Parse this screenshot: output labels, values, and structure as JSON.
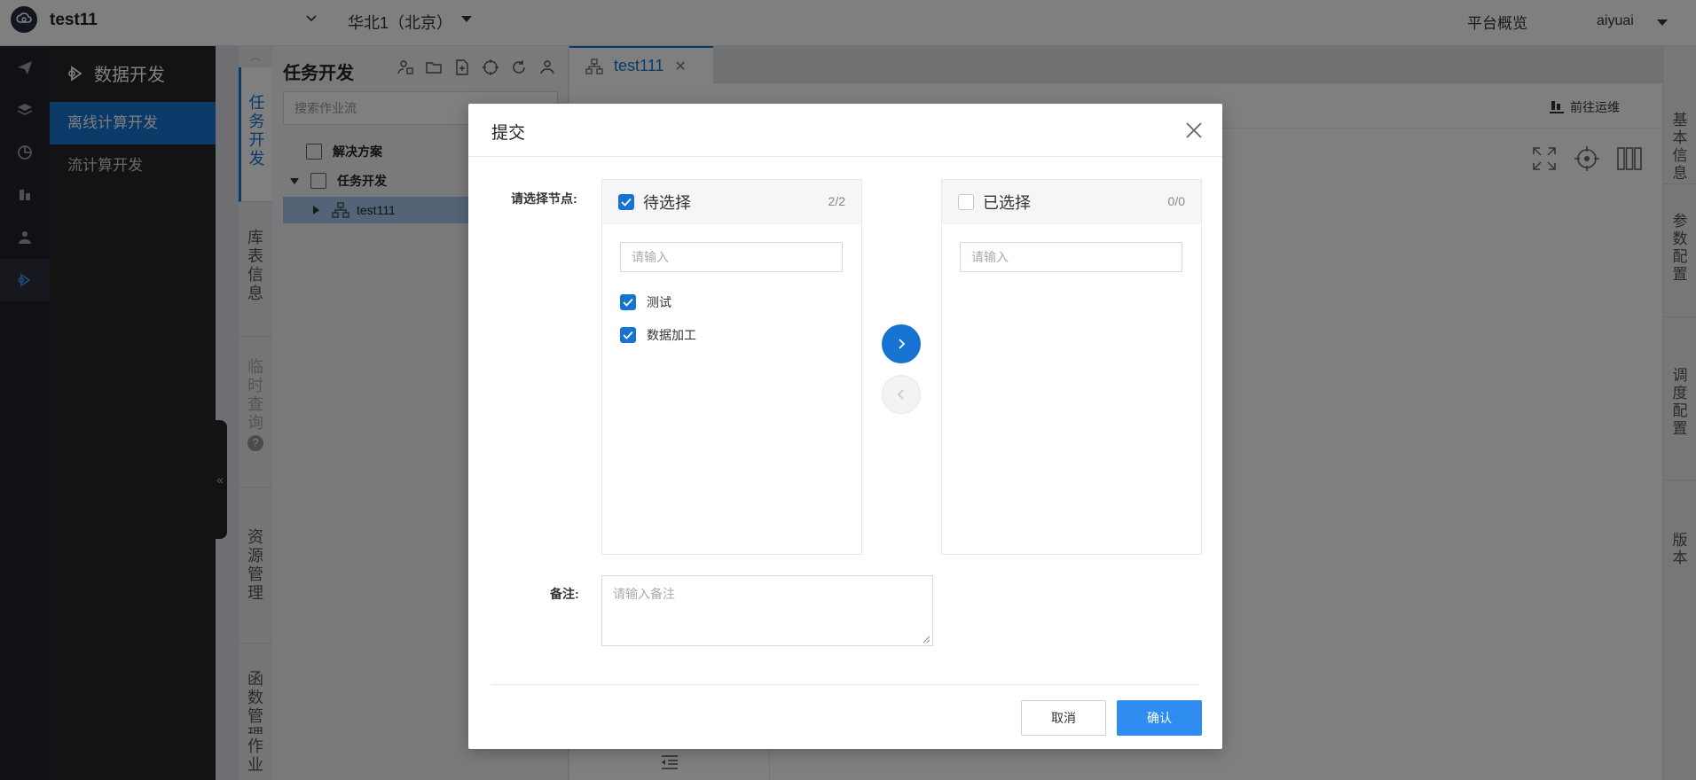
{
  "topbar": {
    "project": "test11",
    "region": "华北1（北京）",
    "overview": "平台概览",
    "user": "aiyuai"
  },
  "nav": {
    "title": "数据开发",
    "items": [
      "离线计算开发",
      "流计算开发"
    ]
  },
  "vtabs": [
    "任务开发",
    "库表信息",
    "临时查询",
    "资源管理",
    "函数管理",
    "作业"
  ],
  "tree": {
    "title": "任务开发",
    "search_placeholder": "搜索作业流",
    "rows": [
      "解决方案",
      "任务开发",
      "test111"
    ]
  },
  "main": {
    "tab_label": "test111",
    "goto_ops": "前往运维"
  },
  "rtabs": [
    "基本信息",
    "参数配置",
    "调度配置",
    "版本"
  ],
  "modal": {
    "title": "提交",
    "select_label": "请选择节点:",
    "left_panel": {
      "title": "待选择",
      "count": "2/2",
      "placeholder": "请输入",
      "items": [
        "测试",
        "数据加工"
      ]
    },
    "right_panel": {
      "title": "已选择",
      "count": "0/0",
      "placeholder": "请输入"
    },
    "remark_label": "备注:",
    "remark_placeholder": "请输入备注",
    "cancel": "取消",
    "confirm": "确认"
  },
  "colors": {
    "primary": "#1673d1",
    "confirm": "#2f8cf0",
    "sidebar_dark": "#262626"
  }
}
